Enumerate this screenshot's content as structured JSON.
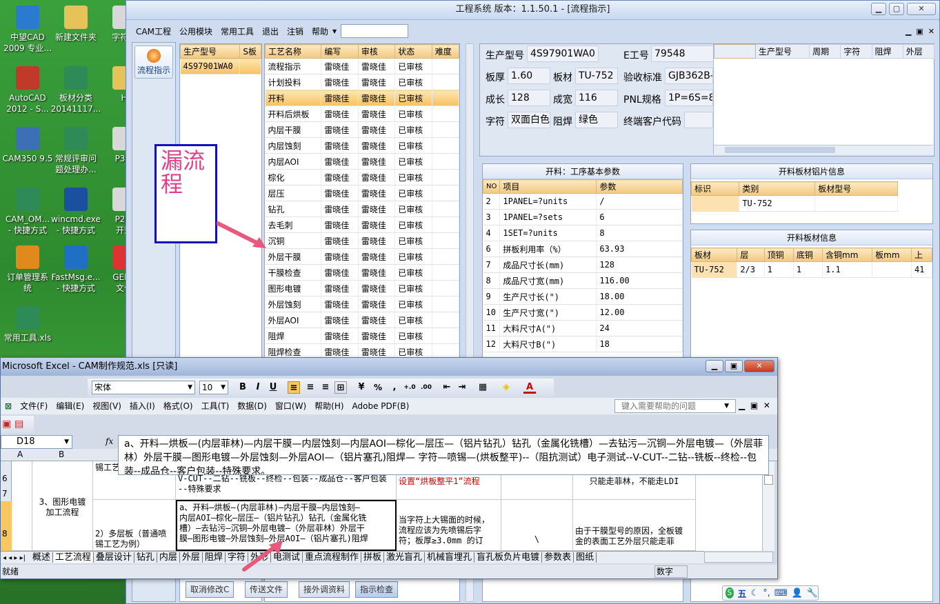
{
  "desktop": {
    "icons": [
      {
        "label": "中望CAD\n2009 专业..."
      },
      {
        "label": "新建文件夹"
      },
      {
        "label": "字符..."
      },
      {
        "label": "AutoCAD\n2012 - S..."
      },
      {
        "label": "板材分类\n20141117..."
      },
      {
        "label": "H"
      },
      {
        "label": "CAM350 9.5"
      },
      {
        "label": "常规评审问\n题处理办..."
      },
      {
        "label": "P3规"
      },
      {
        "label": "CAM_OM...\n- 快捷方式"
      },
      {
        "label": "wincmd.exe\n- 快捷方式"
      },
      {
        "label": "P2铜\n开剩"
      },
      {
        "label": "订单管理系\n统"
      },
      {
        "label": "FastMsg.e...\n- 快捷方式"
      },
      {
        "label": "GENE\n文件"
      },
      {
        "label": "常用工具.xls"
      }
    ]
  },
  "app": {
    "title": "工程系统   版本：1.1.50.1 - [流程指示]",
    "menu": [
      "CAM工程",
      "公用模块",
      "常用工具",
      "退出",
      "注销",
      "帮助"
    ],
    "nav_button": "流程指示",
    "prod_table": {
      "headers": [
        "生产型号",
        "S板"
      ],
      "rows": [
        [
          "4S97901WA0",
          ""
        ]
      ]
    },
    "process_table": {
      "headers": [
        "工艺名称",
        "编写",
        "审核",
        "状态",
        "难度"
      ],
      "rows": [
        [
          "流程指示",
          "雷晓佳",
          "雷晓佳",
          "已审核",
          ""
        ],
        [
          "计划投料",
          "雷晓佳",
          "雷晓佳",
          "已审核",
          ""
        ],
        [
          "开料",
          "雷晓佳",
          "雷晓佳",
          "已审核",
          ""
        ],
        [
          "开料后烘板",
          "雷晓佳",
          "雷晓佳",
          "已审核",
          ""
        ],
        [
          "内层干膜",
          "雷晓佳",
          "雷晓佳",
          "已审核",
          ""
        ],
        [
          "内层蚀刻",
          "雷晓佳",
          "雷晓佳",
          "已审核",
          ""
        ],
        [
          "内层AOI",
          "雷晓佳",
          "雷晓佳",
          "已审核",
          ""
        ],
        [
          "棕化",
          "雷晓佳",
          "雷晓佳",
          "已审核",
          ""
        ],
        [
          "层压",
          "雷晓佳",
          "雷晓佳",
          "已审核",
          ""
        ],
        [
          "钻孔",
          "雷晓佳",
          "雷晓佳",
          "已审核",
          ""
        ],
        [
          "去毛刺",
          "雷晓佳",
          "雷晓佳",
          "已审核",
          ""
        ],
        [
          "沉铜",
          "雷晓佳",
          "雷晓佳",
          "已审核",
          ""
        ],
        [
          "外层干膜",
          "雷晓佳",
          "雷晓佳",
          "已审核",
          ""
        ],
        [
          "干膜检查",
          "雷晓佳",
          "雷晓佳",
          "已审核",
          ""
        ],
        [
          "图形电镀",
          "雷晓佳",
          "雷晓佳",
          "已审核",
          ""
        ],
        [
          "外层蚀刻",
          "雷晓佳",
          "雷晓佳",
          "已审核",
          ""
        ],
        [
          "外层AOI",
          "雷晓佳",
          "雷晓佳",
          "已审核",
          ""
        ],
        [
          "阻焊",
          "雷晓佳",
          "雷晓佳",
          "已审核",
          ""
        ],
        [
          "阻焊检查",
          "雷晓佳",
          "雷晓佳",
          "已审核",
          ""
        ]
      ],
      "selected": 2
    },
    "info": {
      "model_label": "生产型号",
      "model": "4S97901WA0",
      "eno_label": "E工号",
      "eno": "79548",
      "thick_label": "板厚",
      "thick": "1.60",
      "mat_label": "板材",
      "mat": "TU-752",
      "std_label": "验收标准",
      "std": "GJB362B-",
      "len_label": "成长",
      "len": "128",
      "wid_label": "成宽",
      "wid": "116",
      "pnl_label": "PNL规格",
      "pnl": "1P=6S=8U",
      "char_label": "字符",
      "char": "双面白色",
      "mask_label": "阻焊",
      "mask": "绿色",
      "cust_label": "终端客户代码",
      "cust": ""
    },
    "right_table": {
      "headers": [
        "生产型号",
        "周期",
        "字符",
        "阻焊",
        "外层"
      ]
    },
    "params": {
      "title": "开料：工序基本参数",
      "headers": [
        "NO",
        "项目",
        "参数"
      ],
      "rows": [
        [
          "2",
          "1PANEL=?units",
          "/"
        ],
        [
          "3",
          "1PANEL=?sets",
          "6"
        ],
        [
          "4",
          "1SET=?units",
          "8"
        ],
        [
          "6",
          "拼板利用率（%）",
          "63.93"
        ],
        [
          "7",
          "成品尺寸长(mm)",
          "128"
        ],
        [
          "8",
          "成品尺寸宽(mm)",
          "116.00"
        ],
        [
          "9",
          "生产尺寸长(\")",
          "18.00"
        ],
        [
          "10",
          "生产尺寸宽(\")",
          "12.00"
        ],
        [
          "11",
          "大料尺寸A(\")",
          "24"
        ],
        [
          "12",
          "大料尺寸B(\")",
          "18"
        ]
      ]
    },
    "alu": {
      "title": "开料板材铝片信息",
      "headers": [
        "标识",
        "类别",
        "板材型号"
      ],
      "rows": [
        [
          "",
          "TU-752",
          ""
        ]
      ]
    },
    "board": {
      "title": "开料板材信息",
      "headers": [
        "板材",
        "层",
        "顶铜",
        "底铜",
        "含铜mm",
        "板mm",
        "上"
      ],
      "rows": [
        [
          "TU-752",
          "2/3",
          "1",
          "1",
          "1.1",
          "",
          "41"
        ]
      ]
    },
    "bottom_buttons": [
      "取消修改C",
      "传送文件",
      "接外调资料",
      "指示检查"
    ]
  },
  "annotation": {
    "text": "漏流程"
  },
  "excel": {
    "title": "Microsoft Excel - CAM制作规范.xls  [只读]",
    "font": "宋体",
    "size": "10",
    "menu": [
      "文件(F)",
      "编辑(E)",
      "视图(V)",
      "插入(I)",
      "格式(O)",
      "工具(T)",
      "数据(D)",
      "窗口(W)",
      "帮助(H)",
      "Adobe PDF(B)"
    ],
    "help_placeholder": "键入需要帮助的问题",
    "cell_ref": "D18",
    "formula": "a、开料—烘板—(内层菲林)—内层干膜—内层蚀刻—内层AOI—棕化—层压—（铝片钻孔）钻孔（金属化铣槽）—去钻污—沉铜—外层电镀—（外层菲林）外层干膜—图形电镀—外层蚀刻—外层AOI—（铝片塞孔)阻焊— 字符—喷锡—(烘板整平)--（阻抗测试）电子测试--V-CUT--二钻--铣板--终检--包装--成品仓--客户包装--特殊要求。",
    "col_a": "A",
    "col_b": "B",
    "rows": [
      "6",
      "7",
      "8"
    ],
    "b_cell": "3、图形电镀\n加工流程",
    "b_cell2": "2）多层板（普通喷\n锡工艺为例）",
    "cell_tin": "锡工艺",
    "d_top": "V-CUT--二钻--铣板--终检--包装--成品仓--客户包装\n--特殊要求",
    "d_main": "a、开料—烘板—(内层菲林)—内层干膜—内层蚀刻—\n内层AOI—棕化—层压—（铝片钻孔）钻孔（金属化铣\n槽）—去钻污—沉铜—外层电镀—（外层菲林）外层干\n膜—图形电镀—外层蚀刻—外层AOI—（铝片塞孔)阻焊",
    "e_top": "设置“烘板整平1”流程",
    "e_main": "当字符上大锡面的时候，\n流程应该为先喷锡后字\n符；板厚≥3.0mm 的订",
    "f_main": "\\",
    "g_top": "只能走菲林，不能走LDI",
    "g_main": "由于干膜型号的原因，全板镀\n金的表面工艺外层只能走菲",
    "sheet_tabs": [
      "概述",
      "工艺流程",
      "叠层设计",
      "钻孔",
      "内层",
      "外层",
      "阻焊",
      "字符",
      "外形",
      "电测试",
      "重点流程制作",
      "拼板",
      "激光盲孔",
      "机械盲埋孔",
      "盲孔板负片电镀",
      "参数表",
      "图纸"
    ],
    "status_left": "就绪",
    "status_right": "数字"
  },
  "tray": {
    "ime": "五"
  }
}
